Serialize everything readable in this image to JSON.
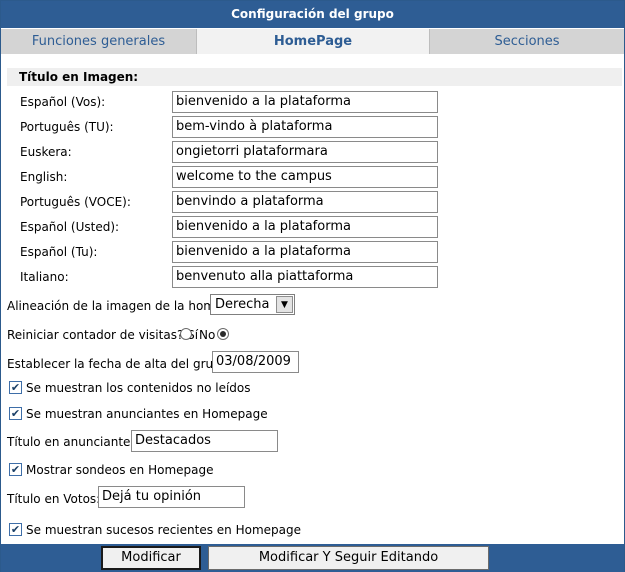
{
  "header": {
    "title": "Configuración del grupo"
  },
  "tabs": [
    {
      "label": "Funciones generales",
      "active": false
    },
    {
      "label": "HomePage",
      "active": true
    },
    {
      "label": "Secciones",
      "active": false
    }
  ],
  "titulo_imagen": {
    "heading": "Título en Imagen:",
    "rows": [
      {
        "label": "Español (Vos):",
        "value": "bienvenido a la plataforma"
      },
      {
        "label": "Português (TU):",
        "value": "bem-vindo à plataforma"
      },
      {
        "label": "Euskera:",
        "value": "ongietorri plataformara"
      },
      {
        "label": "English:",
        "value": "welcome to the campus"
      },
      {
        "label": "Português (VOCE):",
        "value": "benvindo a plataforma"
      },
      {
        "label": "Español (Usted):",
        "value": "bienvenido a la plataforma"
      },
      {
        "label": "Español (Tu):",
        "value": "bienvenido a la plataforma"
      },
      {
        "label": "Italiano:",
        "value": "benvenuto alla piattaforma"
      }
    ]
  },
  "alineacion": {
    "label": "Alineación de la imagen de la home",
    "selected": "Derecha"
  },
  "reiniciar": {
    "label": "Reiniciar contador de visitas? Sí",
    "yes_checked": false,
    "no_label": "No",
    "no_checked": true
  },
  "fecha_alta": {
    "label": "Establecer la fecha de alta del grupo:",
    "value": "03/08/2009"
  },
  "checks": {
    "no_leidos": {
      "label": "Se muestran los contenidos no leídos",
      "checked": true
    },
    "anunciantes": {
      "label": "Se muestran anunciantes en Homepage",
      "checked": true
    },
    "sondeos": {
      "label": "Mostrar sondeos en Homepage",
      "checked": true
    },
    "sucesos": {
      "label": "Se muestran sucesos recientes en Homepage",
      "checked": true
    }
  },
  "titulo_anunciantes": {
    "label": "Título en anunciantes:",
    "value": "Destacados"
  },
  "titulo_votos": {
    "label": "Título en Votos:",
    "value": "Dejá tu opinión"
  },
  "buttons": {
    "modificar": "Modificar",
    "modificar_seguir": "Modificar Y Seguir Editando"
  },
  "icons": {
    "checkbox": "checkmark-icon",
    "dropdown": "chevron-down-icon"
  },
  "colors": {
    "header_bg": "#2e5d94",
    "tab_bg": "#d4d4d4",
    "tab_active_bg": "#f2f2f2",
    "section_bg": "#efefef"
  }
}
